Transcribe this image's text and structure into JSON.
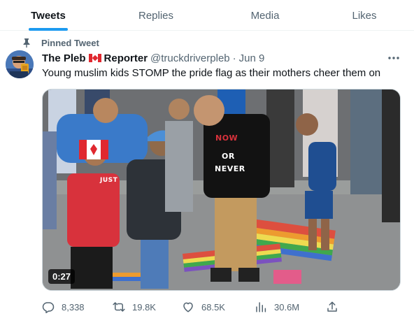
{
  "tabs": [
    {
      "label": "Tweets",
      "active": true
    },
    {
      "label": "Replies",
      "active": false
    },
    {
      "label": "Media",
      "active": false
    },
    {
      "label": "Likes",
      "active": false
    }
  ],
  "pinned_label": "Pinned Tweet",
  "tweet": {
    "display_name_part1": "The Pleb",
    "display_name_part2": "Reporter",
    "name_emoji": "canada-flag-icon",
    "handle": "@truckdriverpleb",
    "separator": "·",
    "date": "Jun 9",
    "text": "Young muslim kids STOMP the pride flag as their mothers cheer them on",
    "video_duration": "0:27",
    "video_text": {
      "shirt_line1": "NOW",
      "shirt_line2": "OR",
      "shirt_line3": "NEVER",
      "shirt_left": "JUST"
    },
    "metrics": {
      "replies": "8,338",
      "retweets": "19.8K",
      "likes": "68.5K",
      "views": "30.6M"
    }
  },
  "icons": {
    "pin": "pin-icon",
    "more": "more-dots-icon",
    "reply": "reply-icon",
    "retweet": "retweet-icon",
    "like": "heart-icon",
    "views": "views-chart-icon",
    "share": "share-icon"
  },
  "colors": {
    "accent": "#1d9bf0",
    "text_primary": "#0f1419",
    "text_secondary": "#536471",
    "divider": "#eff3f4"
  }
}
